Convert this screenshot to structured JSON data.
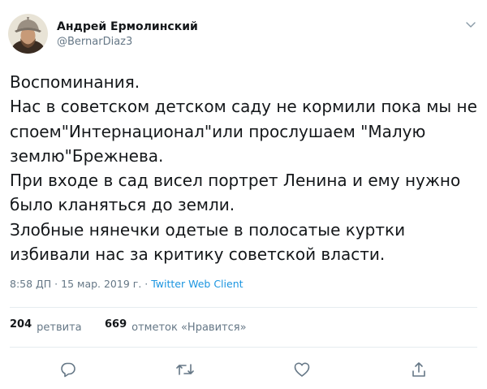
{
  "tweet": {
    "author": {
      "display_name": "Андрей Ермолинский",
      "handle": "@BernarDiaz3"
    },
    "text": "Воспоминания.\nНас в советском детском саду не кормили пока мы не споем\"Интернационал\"или прослушаем \"Малую землю\"Брежнева.\nПри входе в сад висел портрет Ленина и ему нужно было кланяться до земли.\nЗлобные нянечки одетые в полосатые куртки избивали нас за критику советской власти.",
    "timestamp": "8:58 ДП · 15 мар. 2019 г.",
    "separator": " · ",
    "source": "Twitter Web Client",
    "stats": {
      "retweets_count": "204",
      "retweets_label": "ретвита",
      "likes_count": "669",
      "likes_label": "отметок «Нравится»"
    }
  },
  "icons": {
    "menu": "chevron-down-icon",
    "reply": "reply-icon",
    "retweet": "retweet-icon",
    "like": "heart-icon",
    "share": "share-icon"
  },
  "colors": {
    "text": "#14171a",
    "secondary": "#657786",
    "link": "#1b95e0",
    "divider": "#e6ecf0"
  }
}
